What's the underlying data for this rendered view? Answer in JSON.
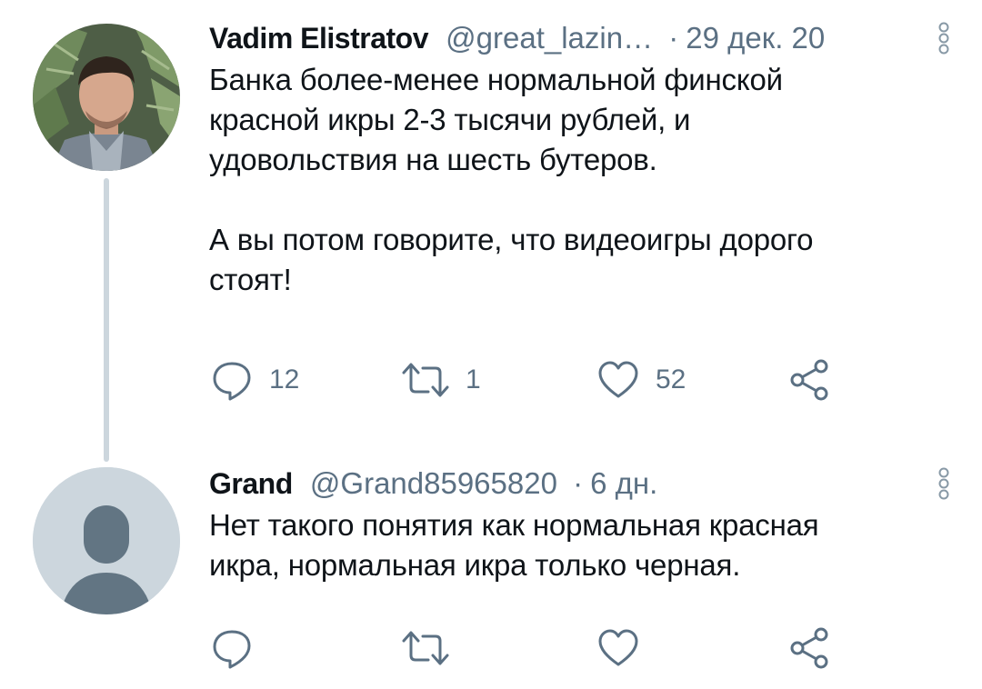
{
  "tweets": [
    {
      "author_name": "Vadim Elistratov",
      "handle": "@great_lazin…",
      "separator": "·",
      "timestamp": "29 дек. 20",
      "text": "Банка более-менее нормальной финской\nкрасной икры 2-3 тысячи рублей, и\nудовольствия на шесть бутеров.\n\nА вы потом говорите, что видеоигры дорого\nстоят!",
      "avatar_icon": "user-photo-avatar",
      "actions": {
        "reply_count": "12",
        "retweet_count": "1",
        "like_count": "52"
      }
    },
    {
      "author_name": "Grand",
      "handle": "@Grand85965820",
      "separator": "·",
      "timestamp": "6 дн.",
      "text": "Нет такого понятия как нормальная красная\nикра, нормальная икра только черная.",
      "avatar_icon": "default-user-avatar",
      "actions": {
        "reply_count": "",
        "retweet_count": "",
        "like_count": ""
      }
    }
  ],
  "colors": {
    "text_primary": "#0f1419",
    "text_secondary": "#5b7083",
    "thread_line": "#ccd6dd",
    "default_avatar_bg": "#ccd6dd",
    "default_avatar_fg": "#627583"
  },
  "icons": [
    "reply-icon",
    "retweet-icon",
    "like-icon",
    "share-icon",
    "more-options-icon"
  ]
}
